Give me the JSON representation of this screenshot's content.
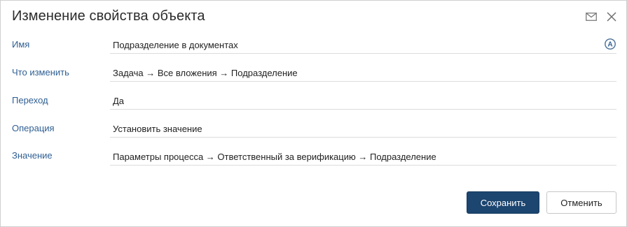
{
  "dialog": {
    "title": "Изменение свойства объекта",
    "icons": {
      "mail": "envelope-icon",
      "close": "close-icon"
    }
  },
  "fields": [
    {
      "label": "Имя",
      "value": "Подразделение в документах",
      "icon": "autofill-a-icon"
    },
    {
      "label": "Что изменить",
      "value": "Задача → Все вложения → Подразделение"
    },
    {
      "label": "Переход",
      "value": "Да"
    },
    {
      "label": "Операция",
      "value": "Установить значение"
    },
    {
      "label": "Значение",
      "value": "Параметры процесса → Ответственный за верификацию → Подразделение"
    }
  ],
  "buttons": {
    "save": "Сохранить",
    "cancel": "Отменить"
  },
  "colors": {
    "label": "#2f5f93",
    "primary_button": "#1c4570",
    "border": "#cfcfcf"
  }
}
